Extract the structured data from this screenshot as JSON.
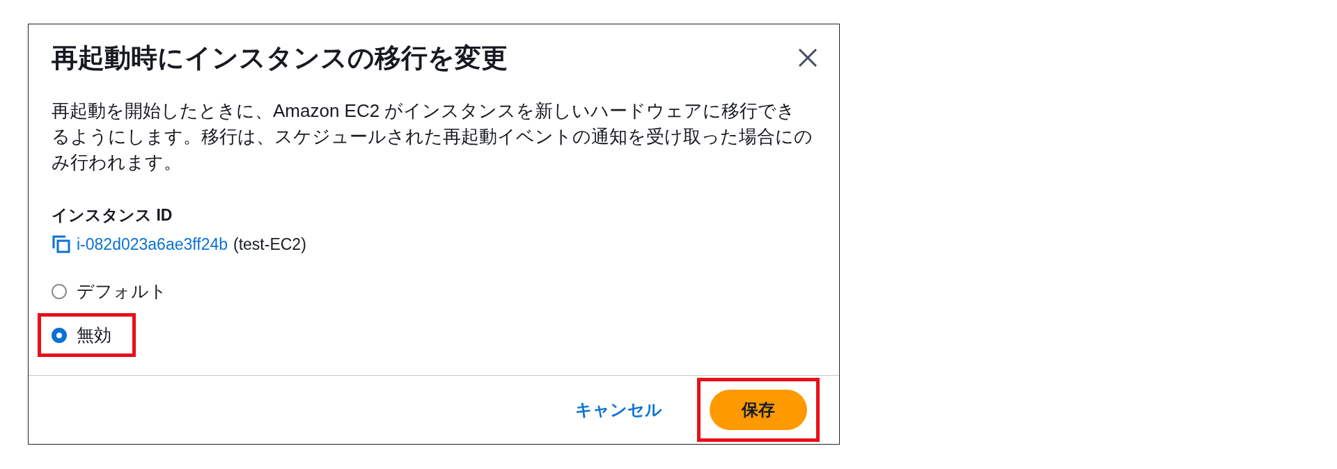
{
  "dialog": {
    "title": "再起動時にインスタンスの移行を変更",
    "description": "再起動を開始したときに、Amazon EC2 がインスタンスを新しいハードウェアに移行できるようにします。移行は、スケジュールされた再起動イベントの通知を受け取った場合にのみ行われます。",
    "instance": {
      "label": "インスタンス ID",
      "id": "i-082d023a6ae3ff24b",
      "name": "(test-EC2)"
    },
    "options": [
      {
        "label": "デフォルト",
        "selected": false,
        "highlighted": false
      },
      {
        "label": "無効",
        "selected": true,
        "highlighted": true
      }
    ],
    "buttons": [
      {
        "label": "キャンセル",
        "kind": "link",
        "highlighted": false
      },
      {
        "label": "保存",
        "kind": "primary",
        "highlighted": true
      }
    ]
  }
}
